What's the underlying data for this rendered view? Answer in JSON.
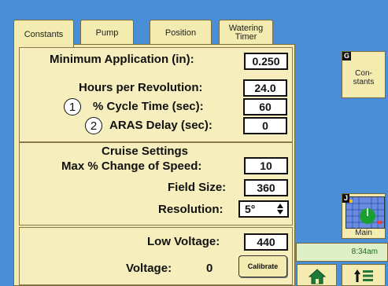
{
  "tabs": [
    {
      "label": "Constants",
      "active": true
    },
    {
      "label": "Pump"
    },
    {
      "label": "Position"
    },
    {
      "label": "Watering\nTimer"
    }
  ],
  "section1": {
    "rows": [
      {
        "label": "Minimum Application (in):",
        "value": "0.250"
      },
      {
        "label": "Hours per Revolution:",
        "value": "24.0"
      },
      {
        "label": "% Cycle Time (sec):",
        "value": "60",
        "callout": "1"
      },
      {
        "label": "ARAS Delay (sec):",
        "value": "0",
        "callout": "2"
      }
    ]
  },
  "section2": {
    "title": "Cruise Settings",
    "rows": [
      {
        "label": "Max % Change of Speed:",
        "value": "10"
      },
      {
        "label": "Field Size:",
        "value": "360"
      },
      {
        "label": "Resolution:",
        "value": "5°"
      }
    ]
  },
  "section3": {
    "low_voltage_label": "Low Voltage:",
    "low_voltage_value": "440",
    "voltage_label": "Voltage:",
    "voltage_value": "0",
    "calibrate_label": "Calibrate"
  },
  "side": {
    "constants_key": "G",
    "constants_label": "Con-\nstants",
    "main_key": "J",
    "main_label": "Main",
    "time": "8:34am"
  },
  "colors": {
    "background": "#4a8ed8",
    "panel": "#f4ebb0",
    "time_bar": "#dff0c8",
    "map_green": "#1aa030"
  }
}
